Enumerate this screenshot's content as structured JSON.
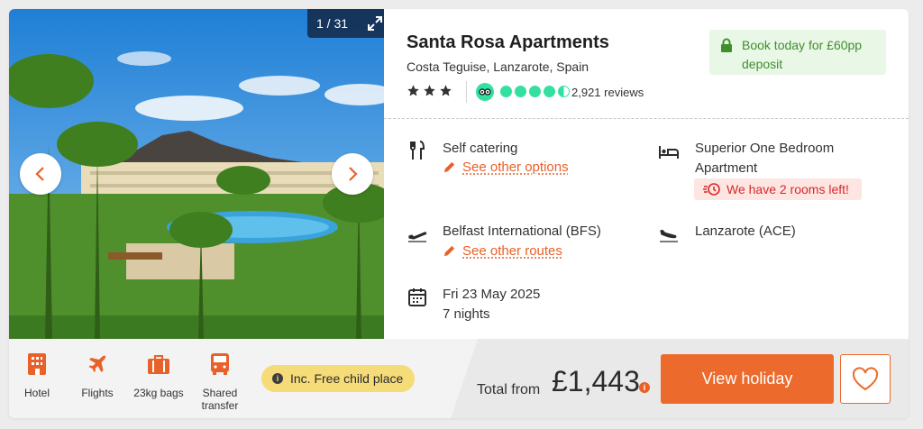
{
  "gallery": {
    "counter": "1 / 31"
  },
  "hotel": {
    "name": "Santa Rosa Apartments",
    "location": "Costa Teguise, Lanzarote, Spain",
    "star_rating": 3,
    "tripadvisor_rating": 4.5,
    "reviews": "2,921 reviews"
  },
  "deposit": {
    "text": "Book today for £60pp deposit"
  },
  "board": {
    "label": "Self catering",
    "link": "See other options"
  },
  "room": {
    "label": "Superior One Bedroom Apartment",
    "alert": "We have 2 rooms left!"
  },
  "departure": {
    "label": "Belfast International (BFS)",
    "link": "See other routes"
  },
  "arrival": {
    "label": "Lanzarote (ACE)"
  },
  "dates": {
    "date": "Fri 23 May 2025",
    "duration": "7 nights"
  },
  "features": [
    {
      "label": "Hotel",
      "icon": "hotel-icon"
    },
    {
      "label": "Flights",
      "icon": "plane-icon"
    },
    {
      "label": "23kg bags",
      "icon": "luggage-icon"
    },
    {
      "label": "Shared transfer",
      "icon": "bus-icon"
    }
  ],
  "child_place": {
    "label": "Inc. Free child place"
  },
  "pricing": {
    "total_label": "Total from",
    "price": "£1,443"
  },
  "actions": {
    "view_label": "View holiday"
  },
  "colors": {
    "accent": "#ec6a2b",
    "deposit_green": "#3f8f2f",
    "alert_red": "#d8282a",
    "tripadvisor": "#34e0a1",
    "child_badge": "#f6dc78"
  }
}
